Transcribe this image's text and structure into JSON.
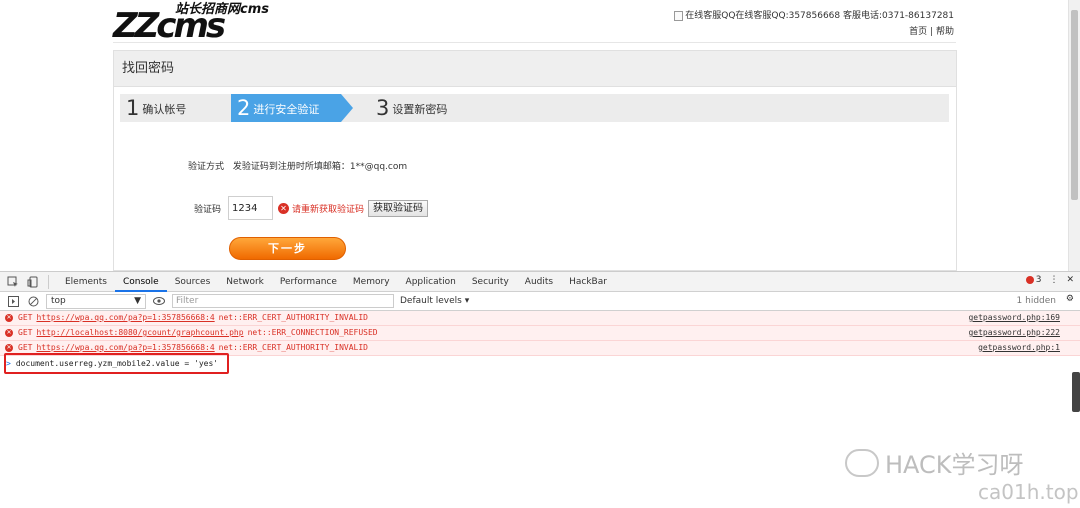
{
  "site": {
    "logo_main": "ZZcms",
    "logo_sub": "站长招商网cms",
    "header_contact": "在线客服QQ在线客服QQ:357856668 客服电话:0371-86137281",
    "link_home": "首页",
    "link_sep": "|",
    "link_help": "帮助"
  },
  "panel": {
    "title": "找回密码",
    "steps": [
      {
        "num": "1",
        "label": "确认帐号"
      },
      {
        "num": "2",
        "label": "进行安全验证"
      },
      {
        "num": "3",
        "label": "设置新密码"
      }
    ],
    "method_label": "验证方式",
    "method_value": "发验证码到注册时所填邮箱：1**@qq.com",
    "code_label": "验证码",
    "code_value": "1234",
    "code_error": "请重新获取验证码",
    "get_code_button": "获取验证码",
    "next_button": "下一步"
  },
  "devtools": {
    "tabs": [
      "Elements",
      "Console",
      "Sources",
      "Network",
      "Performance",
      "Memory",
      "Application",
      "Security",
      "Audits",
      "HackBar"
    ],
    "active_tab": "Console",
    "error_count": "3",
    "context": "top",
    "filter_placeholder": "Filter",
    "levels": "Default levels ▾",
    "hidden": "1 hidden",
    "logs": [
      {
        "method": "GET",
        "url": "https://wpa.qq.com/pa?p=1:357856668:4",
        "msg": "net::ERR_CERT_AUTHORITY_INVALID",
        "source": "getpassword.php:169"
      },
      {
        "method": "GET",
        "url": "http://localhost:8080/gcount/graphcount.php",
        "msg": "net::ERR_CONNECTION_REFUSED",
        "source": "getpassword.php:222"
      },
      {
        "method": "GET",
        "url": "https://wpa.qq.com/pa?p=1:357856668:4",
        "msg": "net::ERR_CERT_AUTHORITY_INVALID",
        "source": "getpassword.php:1"
      }
    ],
    "prompt": ">",
    "command": "document.userreg.yzm_mobile2.value = 'yes'"
  },
  "watermark": {
    "text": "HACK学习呀",
    "domain": "ca01h.top"
  },
  "colors": {
    "step_active": "#4aa3e6",
    "next_button": "#f58a12",
    "error": "#d93025",
    "highlight": "#e02020"
  }
}
